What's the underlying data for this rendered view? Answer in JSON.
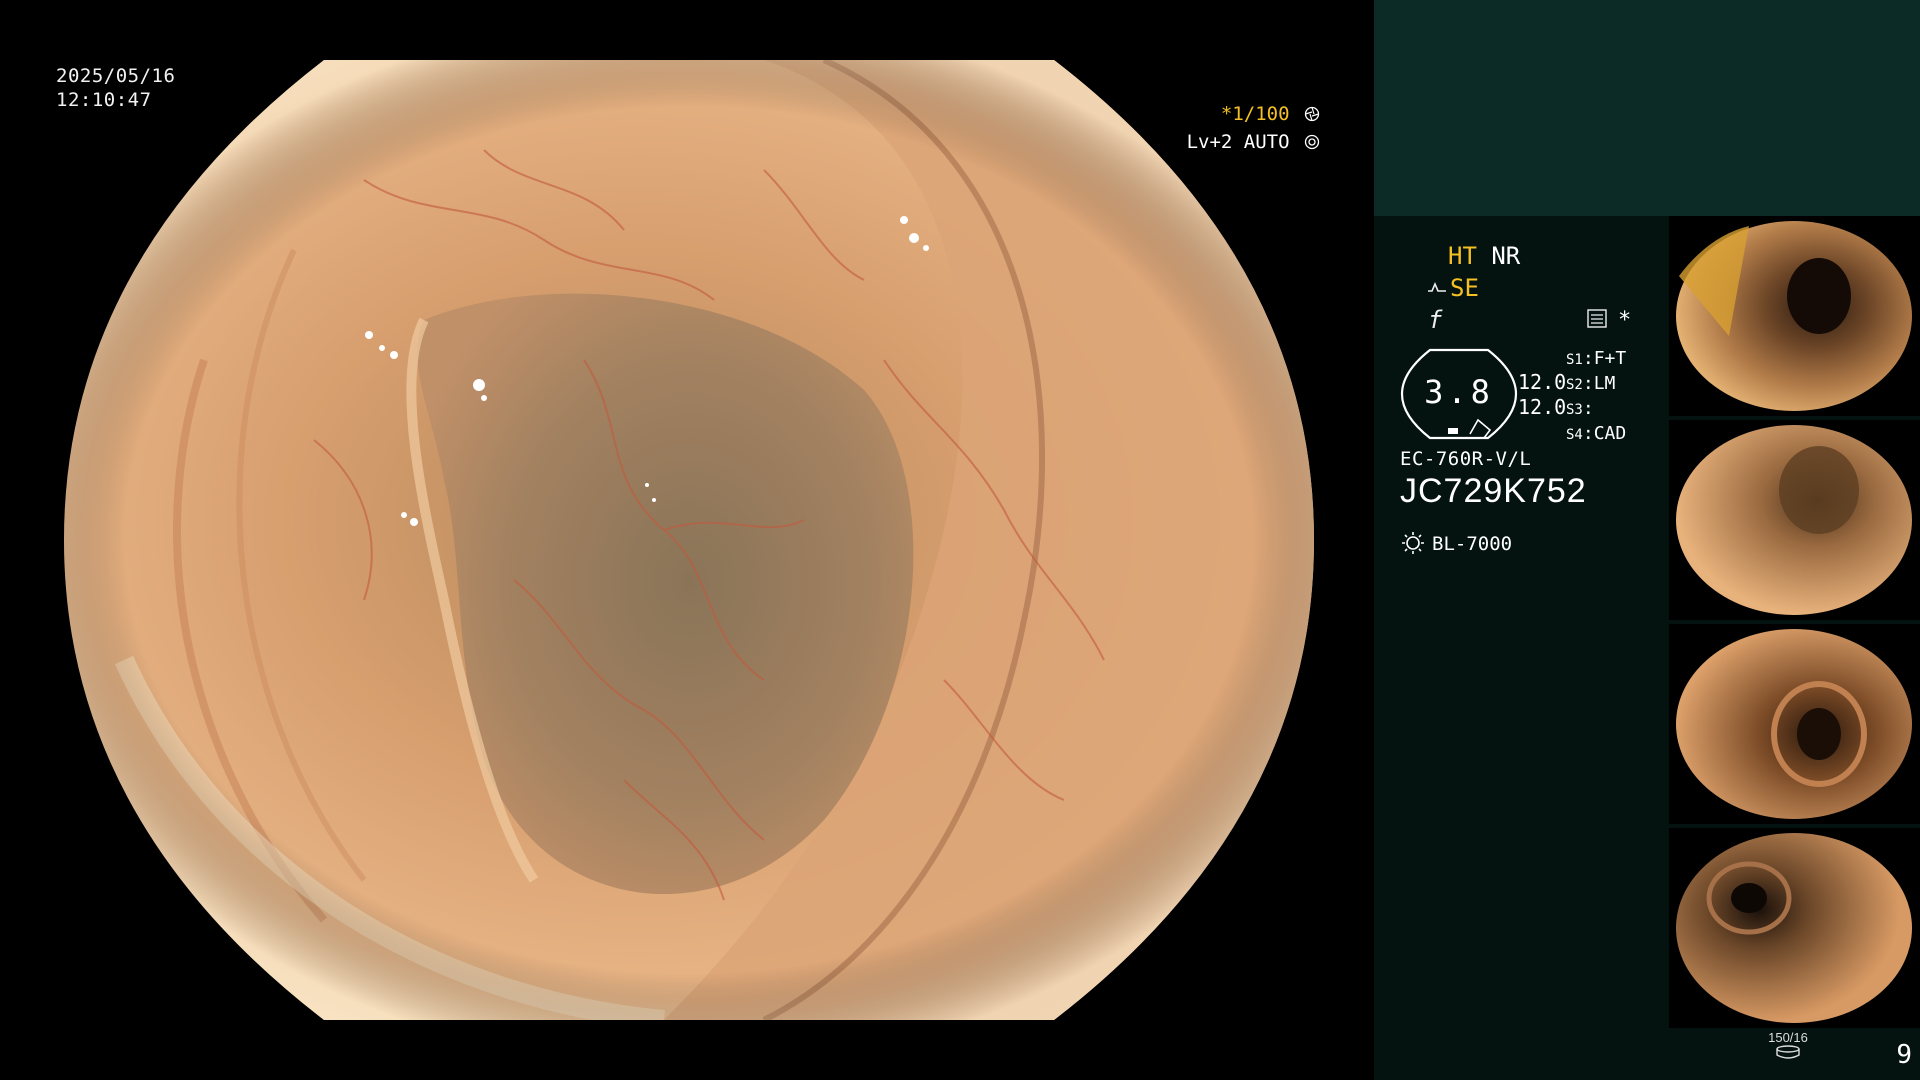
{
  "overlay": {
    "date": "2025/05/16",
    "time": "12:10:47",
    "shutter": "*1/100",
    "level": "Lv+2 AUTO"
  },
  "panel": {
    "ht": "HT",
    "nr": "NR",
    "se": "SE",
    "f_symbol": "f",
    "mode_star": "*",
    "gauge_value": "3.8",
    "gauge_values": [
      "12.0",
      "12.0"
    ],
    "settings": [
      {
        "key": "S1",
        "value": "F+T"
      },
      {
        "key": "S2",
        "value": "LM"
      },
      {
        "key": "S3",
        "value": ""
      },
      {
        "key": "S4",
        "value": "CAD"
      }
    ],
    "scope_model": "EC-760R-V/L",
    "scope_serial": "JC729K752",
    "light_source": "BL-7000",
    "capture_label": "150/16",
    "capture_count": "9"
  },
  "icons": {
    "shutter_icon": "aperture-icon",
    "level_icon": "iris-icon",
    "se_icon": "enhance-curve-icon",
    "mode_icon": "structure-mode-icon",
    "light_icon": "lamp-icon",
    "capture_icon": "storage-icon"
  },
  "colors": {
    "accent_yellow": "#f5c024",
    "panel_background": "#041310",
    "panel_header": "#0c2a26"
  }
}
